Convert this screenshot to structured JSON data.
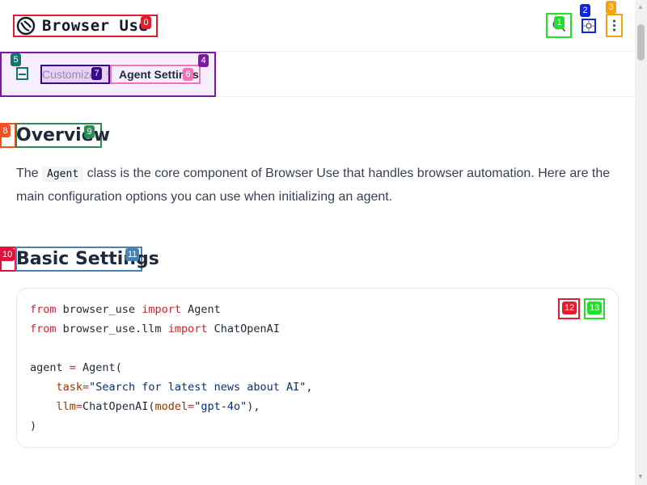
{
  "app": {
    "title": "Browser Use"
  },
  "header": {
    "search_icon": "search-icon",
    "theme_icon": "theme-toggle-icon",
    "more_icon": "more-vertical-icon"
  },
  "breadcrumb": {
    "parent": "Customize",
    "separator": "›",
    "current": "Agent Settings"
  },
  "content": {
    "overview_title": "Overview",
    "intro_before": "The ",
    "intro_code": "Agent",
    "intro_after": " class is the core component of Browser Use that handles browser automation. Here are the main configuration options you can use when initializing an agent.",
    "basic_title": "Basic Settings"
  },
  "code": {
    "lines": [
      "from browser_use import Agent",
      "from browser_use.llm import ChatOpenAI",
      "",
      "agent = Agent(",
      "    task=\"Search for latest news about AI\",",
      "    llm=ChatOpenAI(model=\"gpt-4o\"),",
      ")"
    ],
    "copy_icon": "copy-icon",
    "expand_icon": "expand-icon"
  },
  "tags": [
    {
      "label": "0",
      "color": "#e11d2e"
    },
    {
      "label": "1",
      "color": "#22e02a"
    },
    {
      "label": "2",
      "color": "#1026e0"
    },
    {
      "label": "3",
      "color": "#f5a30a"
    },
    {
      "label": "4",
      "color": "#7a1aa0"
    },
    {
      "label": "5",
      "color": "#0f766e"
    },
    {
      "label": "6",
      "color": "#f472b6"
    },
    {
      "label": "7",
      "color": "#3b0a8a"
    },
    {
      "label": "8",
      "color": "#f4511e"
    },
    {
      "label": "9",
      "color": "#2e8b57"
    },
    {
      "label": "10",
      "color": "#dc143c"
    },
    {
      "label": "11",
      "color": "#4682b4"
    },
    {
      "label": "12",
      "color": "#e11d2e"
    },
    {
      "label": "13",
      "color": "#22e02a"
    }
  ]
}
